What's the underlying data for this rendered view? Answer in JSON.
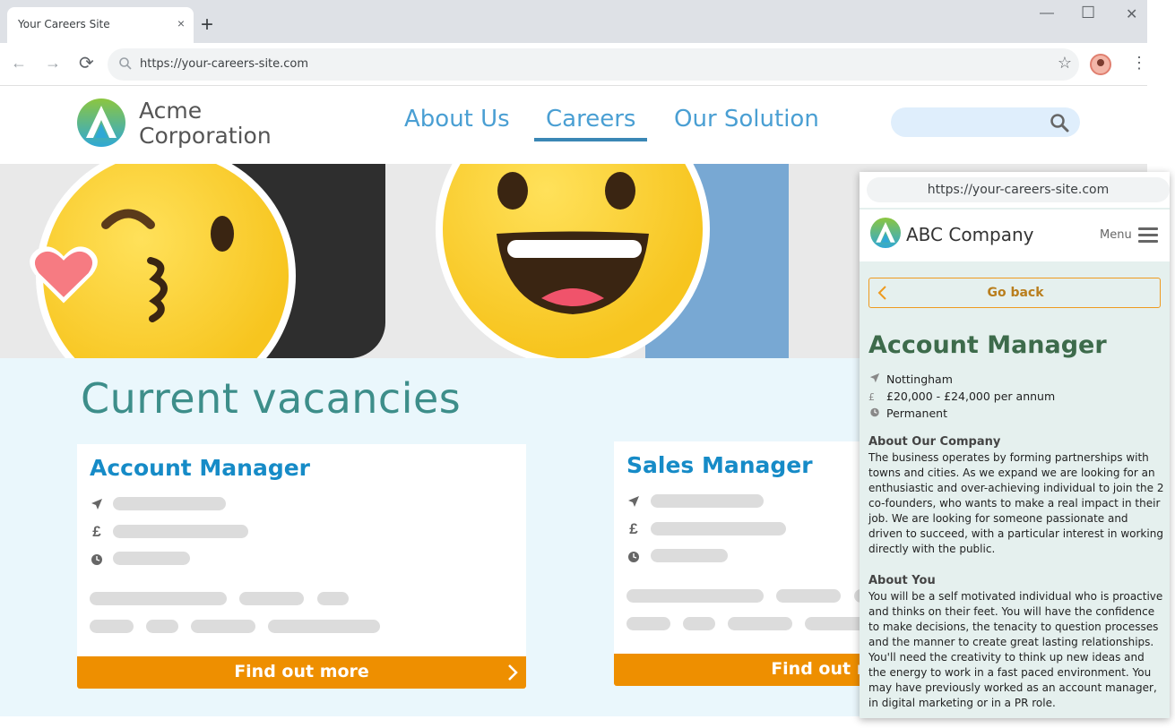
{
  "browser": {
    "tab_title": "Your Careers Site",
    "tab_close": "×",
    "new_tab": "+",
    "url": "https://your-careers-site.com",
    "minimize": "—",
    "maximize": "☐",
    "close": "✕",
    "back": "←",
    "forward": "→",
    "reload": "⟳",
    "star": "☆",
    "menu": "⋮"
  },
  "site": {
    "brand_line1": "Acme",
    "brand_line2": "Corporation",
    "nav": [
      "About Us",
      "Careers",
      "Our Solution"
    ],
    "active_nav": "Careers",
    "colors": {
      "accent": "#4a9fd3",
      "button": "#ee8f00",
      "heading": "#3d8e8a"
    }
  },
  "vacancies": {
    "title": "Current vacancies",
    "cards": [
      {
        "title": "Account Manager",
        "button": "Find out more"
      },
      {
        "title": "Sales Manager",
        "button": "Find out more"
      }
    ],
    "icons": {
      "location": "location-arrow-icon",
      "salary": "pound-icon",
      "type": "clock-icon"
    },
    "salary_symbol": "£"
  },
  "mobile": {
    "url": "https://your-careers-site.com",
    "brand": "ABC Company",
    "menu_label": "Menu",
    "go_back": "Go back",
    "job_title": "Account Manager",
    "location": "Nottingham",
    "salary": "£20,000 - £24,000 per annum",
    "salary_symbol": "£",
    "type": "Permanent",
    "about_company_heading": "About Our Company",
    "about_company_text": "The business operates by forming partnerships with towns and cities. As we expand we are looking for an enthusiastic and over-achieving individual to join the 2 co-founders, who wants to make a real impact in their job. We are looking for someone passionate and driven to succeed, with a particular interest in working directly with the public.",
    "about_you_heading": "About You",
    "about_you_text": "You will be a self motivated individual who is proactive and thinks on their feet. You will have the confidence to make decisions, the tenacity to question processes and the manner to create great lasting relationships. You'll need the creativity to think up new ideas and the energy to work in a fast paced environment. You may have previously worked as an account manager, in digital marketing or in a PR role."
  }
}
